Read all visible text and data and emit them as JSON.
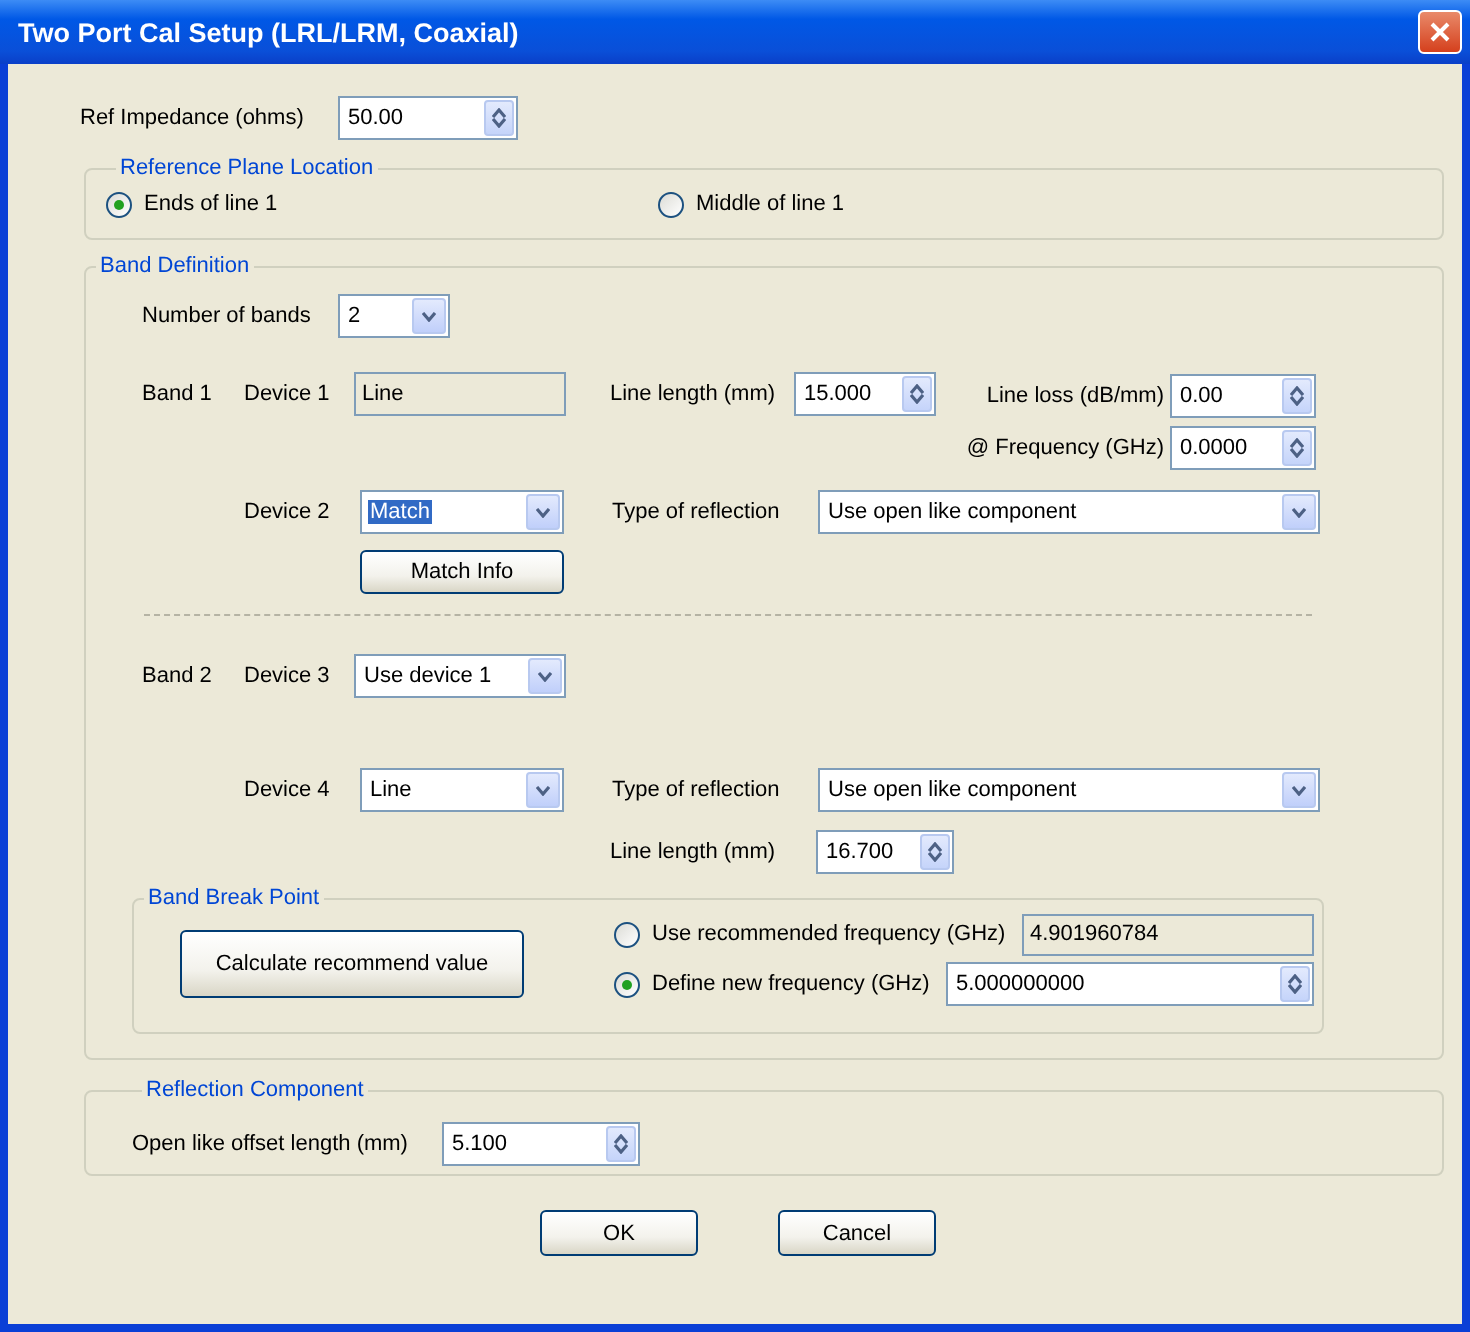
{
  "window": {
    "title": "Two Port Cal Setup (LRL/LRM, Coaxial)"
  },
  "ref_impedance": {
    "label": "Ref Impedance (ohms)",
    "value": "50.00"
  },
  "reference_plane": {
    "legend": "Reference Plane Location",
    "options": [
      {
        "label": "Ends of line 1",
        "selected": true
      },
      {
        "label": "Middle of line 1",
        "selected": false
      }
    ]
  },
  "band_definition": {
    "legend": "Band Definition",
    "number_of_bands": {
      "label": "Number of bands",
      "value": "2"
    },
    "band_1": {
      "label": "Band 1",
      "device_1": {
        "label": "Device 1",
        "value": "Line"
      },
      "line_length": {
        "label": "Line length (mm)",
        "value": "15.000"
      },
      "line_loss": {
        "label": "Line loss (dB/mm)",
        "value": "0.00"
      },
      "frequency": {
        "label": "@ Frequency (GHz)",
        "value": "0.0000"
      },
      "device_2": {
        "label": "Device 2",
        "value": "Match",
        "highlighted": true
      },
      "reflection": {
        "label": "Type of reflection",
        "value": "Use open like component"
      },
      "match_info_button": "Match Info"
    },
    "band_2": {
      "label": "Band 2",
      "device_3": {
        "label": "Device 3",
        "value": "Use device 1"
      },
      "device_4": {
        "label": "Device 4",
        "value": "Line"
      },
      "reflection": {
        "label": "Type of reflection",
        "value": "Use open like component"
      },
      "line_length": {
        "label": "Line length (mm)",
        "value": "16.700"
      }
    },
    "break_point": {
      "legend": "Band Break Point",
      "calculate_button": "Calculate recommend value",
      "options": [
        {
          "label": "Use recommended frequency (GHz)",
          "value": "4.901960784",
          "kind": "readonly",
          "selected": false
        },
        {
          "label": "Define new frequency (GHz)",
          "value": "5.000000000",
          "kind": "spinner",
          "selected": true
        }
      ]
    }
  },
  "reflection_component": {
    "legend": "Reflection Component",
    "label": "Open like offset length (mm)",
    "value": "5.100"
  },
  "buttons": [
    "OK",
    "Cancel"
  ]
}
